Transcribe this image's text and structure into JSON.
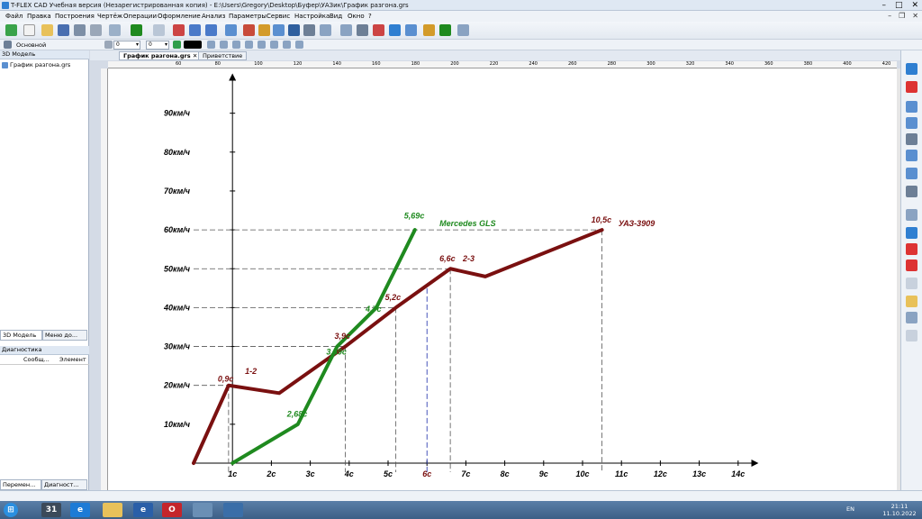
{
  "window": {
    "title": "T-FLEX CAD Учебная версия (Незарегистрированная копия) - E:\\Users\\Gregory\\Desktop\\Буфер\\УАЗик\\График разгона.grs"
  },
  "menu": [
    "Файл",
    "Правка",
    "Построения",
    "Чертёж",
    "Операции",
    "Оформление",
    "Анализ",
    "Параметры",
    "Сервис",
    "Настройка",
    "Вид",
    "Окно",
    "?"
  ],
  "toolbar2": {
    "layer_label": "Основной",
    "combo1_value": "0",
    "combo2_value": "0"
  },
  "left_panel": {
    "header": "3D Модель",
    "tree_item": "График разгона.grs",
    "tab1": "3D Модель",
    "tab2": "Меню до...",
    "diag_header": "Диагностика",
    "diag_col1": "Сообщ...",
    "diag_col2": "Элемент",
    "bottom_tab1": "Перемен...",
    "bottom_tab2": "Диагност..."
  },
  "doc_tabs": [
    "График разгона.grs",
    "Приветствие"
  ],
  "ruler_top_labels": [
    "60",
    "80",
    "100",
    "120",
    "140",
    "160",
    "180",
    "200",
    "220",
    "240",
    "260",
    "280",
    "300",
    "320",
    "340",
    "360",
    "380",
    "400",
    "420"
  ],
  "taskbar": {
    "lang": "EN",
    "time": "21:11",
    "date": "11.10.2022"
  },
  "chart_data": {
    "type": "line",
    "x_unit": "s",
    "y_unit": "km/h",
    "xlim": [
      0,
      14.5
    ],
    "ylim": [
      0,
      100
    ],
    "x_ticks": [
      1,
      2,
      3,
      4,
      5,
      6,
      7,
      8,
      9,
      10,
      11,
      12,
      13,
      14
    ],
    "x_tick_labels": [
      "1c",
      "2c",
      "3c",
      "4c",
      "5c",
      "6c",
      "7c",
      "8c",
      "9c",
      "10c",
      "11c",
      "12c",
      "13c",
      "14c"
    ],
    "y_ticks": [
      10,
      20,
      30,
      40,
      50,
      60,
      70,
      80,
      90
    ],
    "y_tick_labels": [
      "10км/ч",
      "20км/ч",
      "30км/ч",
      "40км/ч",
      "50км/ч",
      "60км/ч",
      "70км/ч",
      "80км/ч",
      "90км/ч"
    ],
    "grid": false,
    "series": [
      {
        "name": "УАЗ-3909",
        "color": "#7a1010",
        "x": [
          0,
          0.9,
          2.2,
          3.9,
          5.2,
          6.6,
          7.5,
          10.5
        ],
        "y": [
          0,
          20,
          18,
          30,
          40,
          50,
          48,
          60
        ]
      },
      {
        "name": "Mercedes GLS",
        "color": "#1f8a1f",
        "x": [
          1.0,
          2.68,
          3.69,
          4.7,
          5.69
        ],
        "y": [
          0,
          10,
          30,
          40,
          60
        ],
        "x_offset": 1.0
      }
    ],
    "annotations": [
      {
        "text": "0,9c",
        "x": 0.9,
        "y": 20,
        "color": "#7a1010"
      },
      {
        "text": "1-2",
        "x": 1.6,
        "y": 22,
        "color": "#7a1010"
      },
      {
        "text": "3,9c",
        "x": 3.9,
        "y": 31,
        "color": "#7a1010"
      },
      {
        "text": "5,2c",
        "x": 5.2,
        "y": 41,
        "color": "#7a1010"
      },
      {
        "text": "6,6c",
        "x": 6.6,
        "y": 51,
        "color": "#7a1010"
      },
      {
        "text": "2-3",
        "x": 7.2,
        "y": 51,
        "color": "#7a1010"
      },
      {
        "text": "10,5c",
        "x": 10.5,
        "y": 61,
        "color": "#7a1010"
      },
      {
        "text": "УАЗ-3909",
        "x": 11.2,
        "y": 60,
        "color": "#7a1010"
      },
      {
        "text": "2,68c",
        "x": 2.68,
        "y": 11,
        "color": "#1f8a1f"
      },
      {
        "text": "3,69c",
        "x": 3.69,
        "y": 27,
        "color": "#1f8a1f"
      },
      {
        "text": "4,7c",
        "x": 4.7,
        "y": 38,
        "color": "#1f8a1f"
      },
      {
        "text": "5,69c",
        "x": 5.69,
        "y": 62,
        "color": "#1f8a1f"
      },
      {
        "text": "Mercedes GLS",
        "x": 6.6,
        "y": 60,
        "color": "#1f8a1f"
      }
    ],
    "dashed_guides": [
      {
        "x": 0.9,
        "y": 20,
        "color": "#555"
      },
      {
        "x": 3.9,
        "y": 30,
        "color": "#555"
      },
      {
        "x": 5.2,
        "y": 40,
        "color": "#555"
      },
      {
        "x": 6.6,
        "y": 50,
        "color": "#555"
      },
      {
        "x": 10.5,
        "y": 60,
        "color": "#555"
      },
      {
        "x": 6.0,
        "y": 45,
        "color": "#1a2aa8"
      }
    ]
  }
}
